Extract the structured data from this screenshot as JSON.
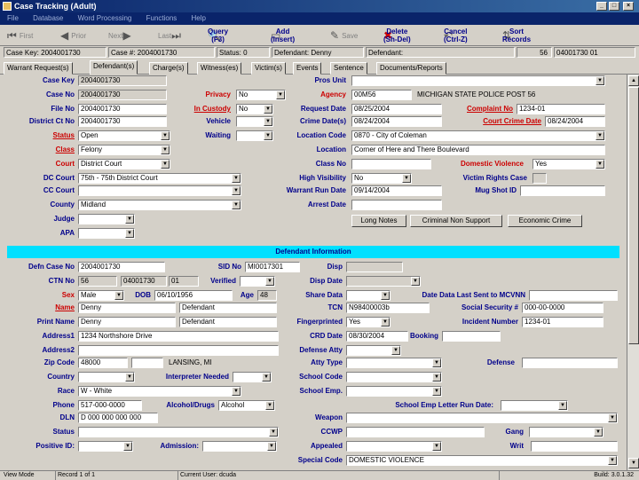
{
  "window": {
    "title": "Case Tracking (Adult)"
  },
  "menu": [
    "File",
    "Database",
    "Word Processing",
    "Functions",
    "Help"
  ],
  "toolbar": {
    "first": "First",
    "prior": "Prior",
    "next": "Next",
    "last": "Last",
    "query": "Query\n(F3)",
    "add": "Add\n(Insert)",
    "save": "Save",
    "delete": "Delete\n(Sh-Del)",
    "cancel": "Cancel\n(Ctrl-Z)",
    "sort": "Sort\nRecords"
  },
  "infobar": {
    "case_key": "Case Key: 2004001730",
    "case_num": "Case #: 2004001730",
    "status": "Status: 0",
    "defendant": "Defendant: Denny",
    "defendant2": "Defendant:",
    "num": "56",
    "code": "04001730 01"
  },
  "tabs": [
    "Warrant Request(s)",
    "Defendant(s)",
    "Charge(s)",
    "Witness(es)",
    "Victim(s)",
    "Events",
    "Sentence",
    "Documents/Reports"
  ],
  "labels": {
    "case_key": "Case Key",
    "case_no": "Case No",
    "file_no": "File No",
    "district_ct_no": "District Ct No",
    "status": "Status",
    "class": "Class",
    "court": "Court",
    "dc_court": "DC Court",
    "cc_court": "CC Court",
    "county": "County",
    "judge": "Judge",
    "apa": "APA",
    "privacy": "Privacy",
    "in_custody": "In Custody",
    "vehicle": "Vehicle",
    "waiting": "Waiting",
    "pros_unit": "Pros Unit",
    "agency": "Agency",
    "request_date": "Request Date",
    "crime_dates": "Crime Date(s)",
    "location_code": "Location Code",
    "location": "Location",
    "class_no": "Class No",
    "high_visibility": "High Visibility",
    "warrant_run_date": "Warrant Run Date",
    "arrest_date": "Arrest Date",
    "complaint_no": "Complaint No",
    "court_crime_date": "Court Crime Date",
    "domestic_violence": "Domestic Violence",
    "victim_rights_case": "Victim Rights Case",
    "mug_shot_id": "Mug Shot ID",
    "defn_case_no": "Defn Case No",
    "ctn_no": "CTN No",
    "sex": "Sex",
    "name": "Name",
    "print_name": "Print Name",
    "address1": "Address1",
    "address2": "Address2",
    "zip_code": "Zip Code",
    "country": "Country",
    "race": "Race",
    "phone": "Phone",
    "dln": "DLN",
    "status2": "Status",
    "positive_id": "Positive ID:",
    "sid_no": "SID No",
    "verified": "Verified",
    "dob": "DOB",
    "age": "Age",
    "interpreter_needed": "Interpreter Needed",
    "alcohol_drugs": "Alcohol/Drugs",
    "admission": "Admission:",
    "disp": "Disp",
    "disp_date": "Disp Date",
    "share_data": "Share Data",
    "tcn": "TCN",
    "fingerprinted": "Fingerprinted",
    "crd_date": "CRD Date",
    "defense_atty": "Defense Atty",
    "atty_type": "Atty Type",
    "school_code": "School Code",
    "school_emp": "School Emp.",
    "weapon": "Weapon",
    "ccwp": "CCWP",
    "appealed": "Appealed",
    "special_code": "Special Code",
    "date_data_last_sent": "Date Data Last Sent to MCVNN",
    "social_security": "Social Security #",
    "incident_number": "Incident Number",
    "booking": "Booking",
    "defense": "Defense",
    "school_emp_letter_run_date": "School Emp Letter Run Date:",
    "gang": "Gang",
    "writ": "Writ"
  },
  "values": {
    "case_key": "2004001730",
    "case_no": "2004001730",
    "file_no": "2004001730",
    "district_ct_no": "2004001730",
    "status": "Open",
    "class": "Felony",
    "court": "District Court",
    "dc_court": "75th - 75th District Court",
    "county": "Midland",
    "privacy": "No",
    "in_custody": "No",
    "agency": "00M56",
    "agency_name": "MICHIGAN STATE POLICE POST 56",
    "request_date": "08/25/2004",
    "crime_dates": "08/24/2004",
    "location_code": "0870 - City of Coleman",
    "location": "Corner of Here and There Boulevard",
    "high_visibility": "No",
    "warrant_run_date": "09/14/2004",
    "complaint_no": "1234-01",
    "court_crime_date": "08/24/2004",
    "domestic_violence": "Yes",
    "defn_case_no": "2004001730",
    "ctn_no": "56",
    "ctn_no2": "04001730",
    "ctn_no3": "01",
    "sex": "Male",
    "name_first": "Denny",
    "name_last": "Defendant",
    "print_first": "Denny",
    "print_last": "Defendant",
    "address1": "1234 Northshore Drive",
    "zip": "48000",
    "city": "LANSING, MI",
    "race": "W - White",
    "phone": "517-000-0000",
    "dln": "D 000 000 000 000",
    "sid_no": "MI0017301",
    "dob": "06/10/1956",
    "age": "48",
    "alcohol_drugs": "Alcohol",
    "tcn": "N98400003b",
    "fingerprinted": "Yes",
    "crd_date": "08/30/2004",
    "social_security": "000-00-0000",
    "incident_number": "1234-01",
    "special_code": "DOMESTIC VIOLENCE"
  },
  "buttons": {
    "long_notes": "Long Notes",
    "criminal_non_support": "Criminal Non Support",
    "economic_crime": "Economic Crime"
  },
  "section": {
    "defendant_info": "Defendant Information"
  },
  "statusbar": {
    "view_mode": "View Mode",
    "record": "Record 1 of 1",
    "user": "Current User: dcuda",
    "build": "Build: 3.0.1.32"
  }
}
